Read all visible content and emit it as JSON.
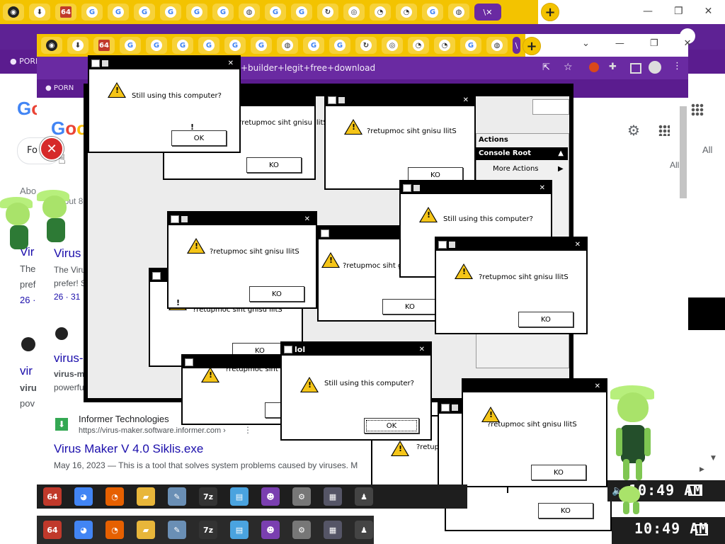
{
  "browser": {
    "active_tab_label": "\\ ",
    "new_tab_symbol": "+",
    "address_text": "+builder+legit+free+download",
    "bookmark_label": "PORN",
    "tab_icons": [
      "github",
      "download",
      "64",
      "G",
      "G",
      "G",
      "G",
      "G",
      "G",
      "globe",
      "G",
      "G",
      "spinner",
      "refresh",
      "loading",
      "loading",
      "G",
      "globe"
    ],
    "tab_glyphs": {
      "github": "◉",
      "download": "⬇",
      "64": "64",
      "G": "G",
      "globe": "◍",
      "spinner": "↻",
      "refresh": "◎",
      "loading": "◔"
    }
  },
  "google": {
    "logo": "Google",
    "search_prefix": "Fo",
    "all_label": "All",
    "about_label": "About 8",
    "results": [
      {
        "title": "Virus",
        "snippet": "The Viru",
        "snippet2": "prefer! S",
        "meta": "26 · 31"
      },
      {
        "title": "virus-",
        "snippet": "virus-m",
        "snippet2": "powerfu"
      },
      {
        "source": "Informer Technologies",
        "url": "https://virus-maker.software.informer.com ›",
        "title": "Virus Maker V 4.0 Siklis.exe",
        "snippet": "May 16, 2023 — This is a tool that solves system problems caused by viruses. M"
      }
    ]
  },
  "mmc": {
    "actions_label": "Actions",
    "console_root": "Console Root",
    "more_actions": "More Actions"
  },
  "dialogs": {
    "title": "lol",
    "message": "Still using this computer?",
    "message_reversed": "?retupmoc siht gnisu llitS",
    "ok_label": "OK",
    "ok_reversed": "KO"
  },
  "taskbar": {
    "time": "10:49 AM",
    "icons": [
      "64bit",
      "chrome",
      "firefox",
      "explorer",
      "paint",
      "7z",
      "notepad",
      "bonzi",
      "control",
      "mmc",
      "person"
    ],
    "icon_labels": {
      "64bit": "64",
      "chrome": "◕",
      "firefox": "◔",
      "explorer": "▰",
      "paint": "✎",
      "7z": "7z",
      "notepad": "▤",
      "bonzi": "☻",
      "control": "⚙",
      "mmc": "▦",
      "person": "♟"
    }
  },
  "colors": {
    "tab_strip": "#f3c300",
    "chrome_purple": "#6a2aa2",
    "dialog_titlebar": "#000000",
    "warning_yellow": "#f5c518",
    "taskbar": "#1e1e1e",
    "link_blue": "#1a0dab"
  }
}
